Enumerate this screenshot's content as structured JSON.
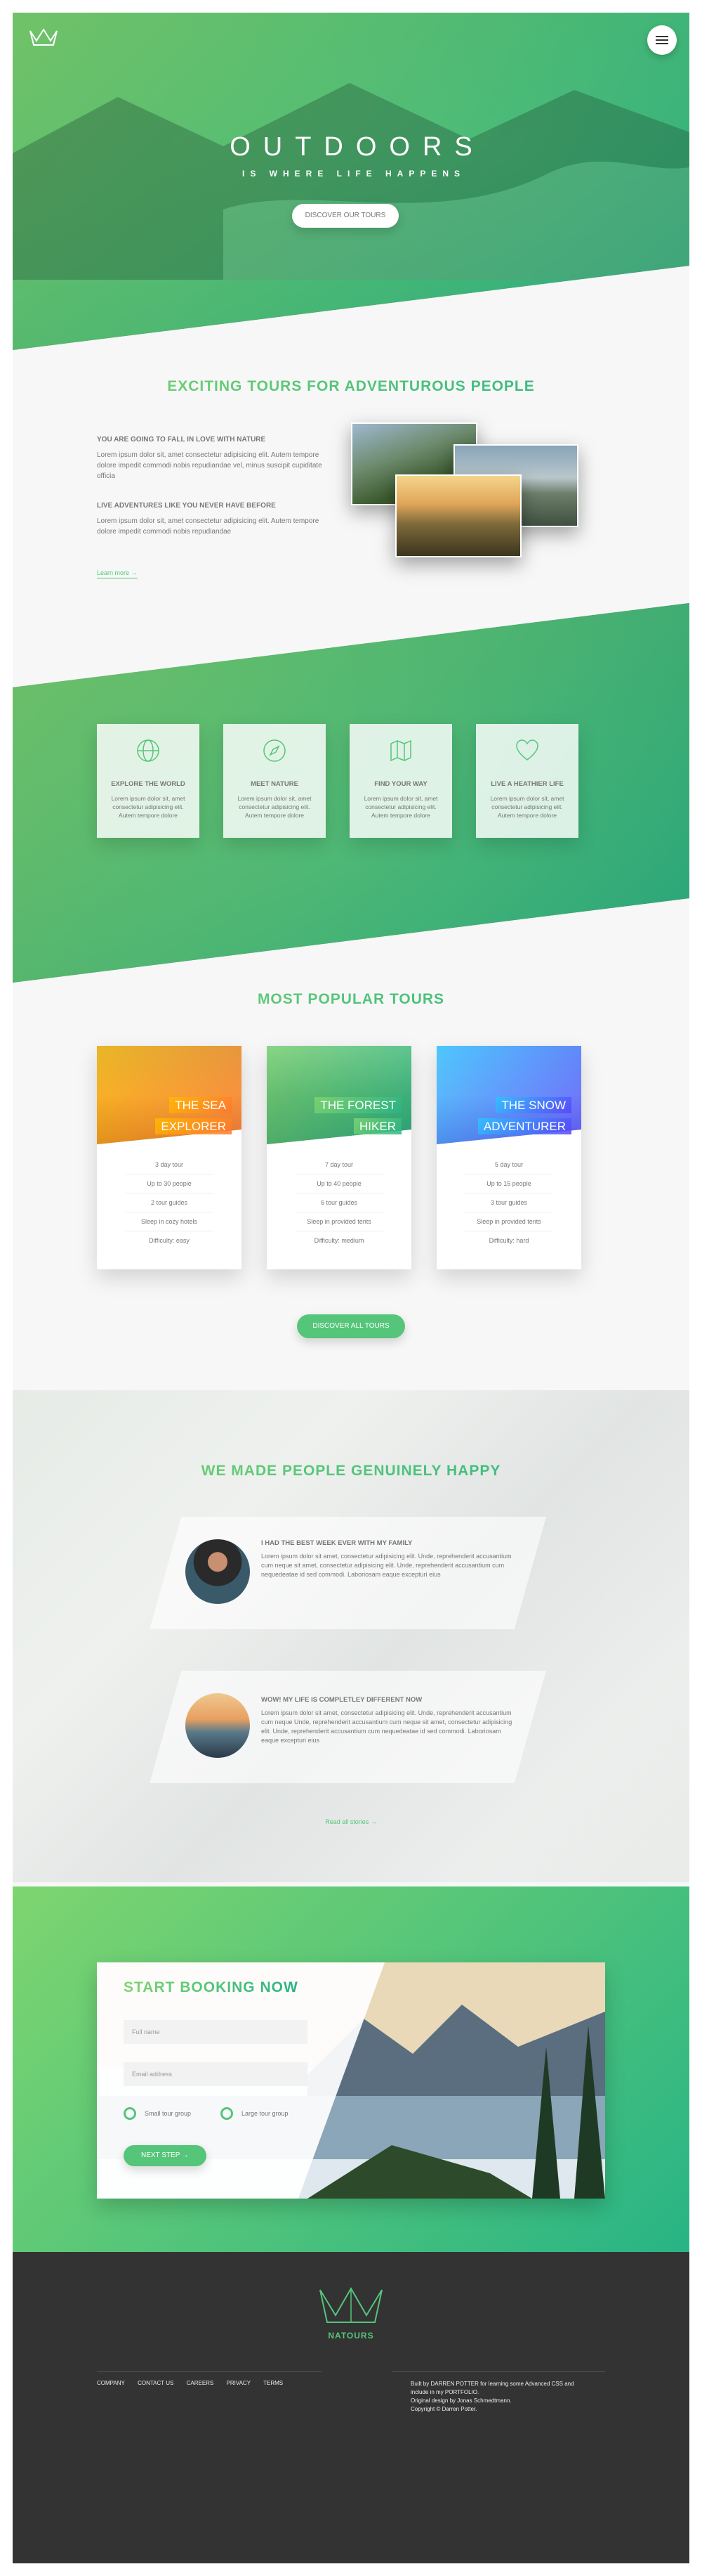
{
  "hero": {
    "title": "OUTDOORS",
    "subtitle": "IS WHERE LIFE HAPPENS",
    "cta": "DISCOVER OUR TOURS",
    "logo_icon": "crown-logo-icon",
    "menu_icon": "hamburger-icon"
  },
  "about": {
    "title": "EXCITING TOURS FOR ADVENTUROUS PEOPLE",
    "h1": "YOU ARE GOING TO FALL IN LOVE WITH NATURE",
    "p1": "Lorem ipsum dolor sit, amet consectetur adipisicing elit. Autem tempore dolore impedit commodi nobis repudiandae vel, minus suscipit cupiditate officia",
    "h2": "LIVE ADVENTURES LIKE YOU NEVER HAVE BEFORE",
    "p2": "Lorem ipsum dolor sit, amet consectetur adipisicing elit. Autem tempore dolore impedit commodi nobis repudiandae",
    "link": "Learn more →"
  },
  "features": [
    {
      "icon": "globe-icon",
      "title": "EXPLORE THE WORLD",
      "text": "Lorem ipsum dolor sit, amet consectetur adipisicing elit. Autem tempore dolore"
    },
    {
      "icon": "compass-icon",
      "title": "MEET NATURE",
      "text": "Lorem ipsum dolor sit, amet consectetur adipisicing elit. Autem tempore dolore"
    },
    {
      "icon": "map-icon",
      "title": "FIND YOUR WAY",
      "text": "Lorem ipsum dolor sit, amet consectetur adipisicing elit. Autem tempore dolore"
    },
    {
      "icon": "heart-icon",
      "title": "LIVE A HEATHIER LIFE",
      "text": "Lorem ipsum dolor sit, amet consectetur adipisicing elit. Autem tempore dolore"
    }
  ],
  "tours": {
    "title": "MOST POPULAR TOURS",
    "cta": "DISCOVER ALL TOURS",
    "cards": [
      {
        "line1": "THE SEA",
        "line2": "EXPLORER",
        "color": "#ffb900",
        "details": [
          "3 day tour",
          "Up to 30 people",
          "2 tour guides",
          "Sleep in cozy hotels",
          "Difficulty: easy"
        ]
      },
      {
        "line1": "THE FOREST",
        "line2": "HIKER",
        "color": "#7ed56f",
        "details": [
          "7 day tour",
          "Up to 40 people",
          "6 tour guides",
          "Sleep in provided tents",
          "Difficulty: medium"
        ]
      },
      {
        "line1": "THE SNOW",
        "line2": "ADVENTURER",
        "color": "#5643fa",
        "details": [
          "5 day tour",
          "Up to 15 people",
          "3 tour guides",
          "Sleep in provided tents",
          "Difficulty: hard"
        ]
      }
    ]
  },
  "stories": {
    "title": "WE MADE PEOPLE GENUINELY HAPPY",
    "items": [
      {
        "heading": "I HAD THE BEST WEEK EVER WITH MY FAMILY",
        "text": "Lorem ipsum dolor sit amet, consectetur adipisicing elit. Unde, reprehenderit accusantium cum neque sit amet, consectetur adipisicing elit. Unde, reprehenderit accusantium cum nequedeatae id sed commodi. Laboriosam eaque excepturi eius"
      },
      {
        "heading": "WOW! MY LIFE IS COMPLETLEY DIFFERENT NOW",
        "text": "Lorem ipsum dolor sit amet, consectetur adipisicing elit. Unde, reprehenderit accusantium cum neque Unde, reprehenderit accusantium cum neque sit amet, consectetur adipisicing elit. Unde, reprehenderit accusantium cum nequedeatae id sed commodi. Laboriosam eaque excepturi eius"
      }
    ],
    "link": "Read all stories →"
  },
  "booking": {
    "title": "START BOOKING NOW",
    "name_placeholder": "Full name",
    "email_placeholder": "Email address",
    "radio1": "Small tour group",
    "radio2": "Large tour group",
    "submit": "NEXT STEP →"
  },
  "footer": {
    "brand": "NATOURS",
    "links": [
      "COMPANY",
      "CONTACT US",
      "CAREERS",
      "PRIVACY",
      "TERMS"
    ],
    "credit1": "Built by DARREN POTTER for learning some Advanced CSS and",
    "credit2": "include in my PORTFOLIO.",
    "credit3": "Original design by Jonas Schmedtmann.",
    "credit4": "Copyright © Darren Potter."
  }
}
